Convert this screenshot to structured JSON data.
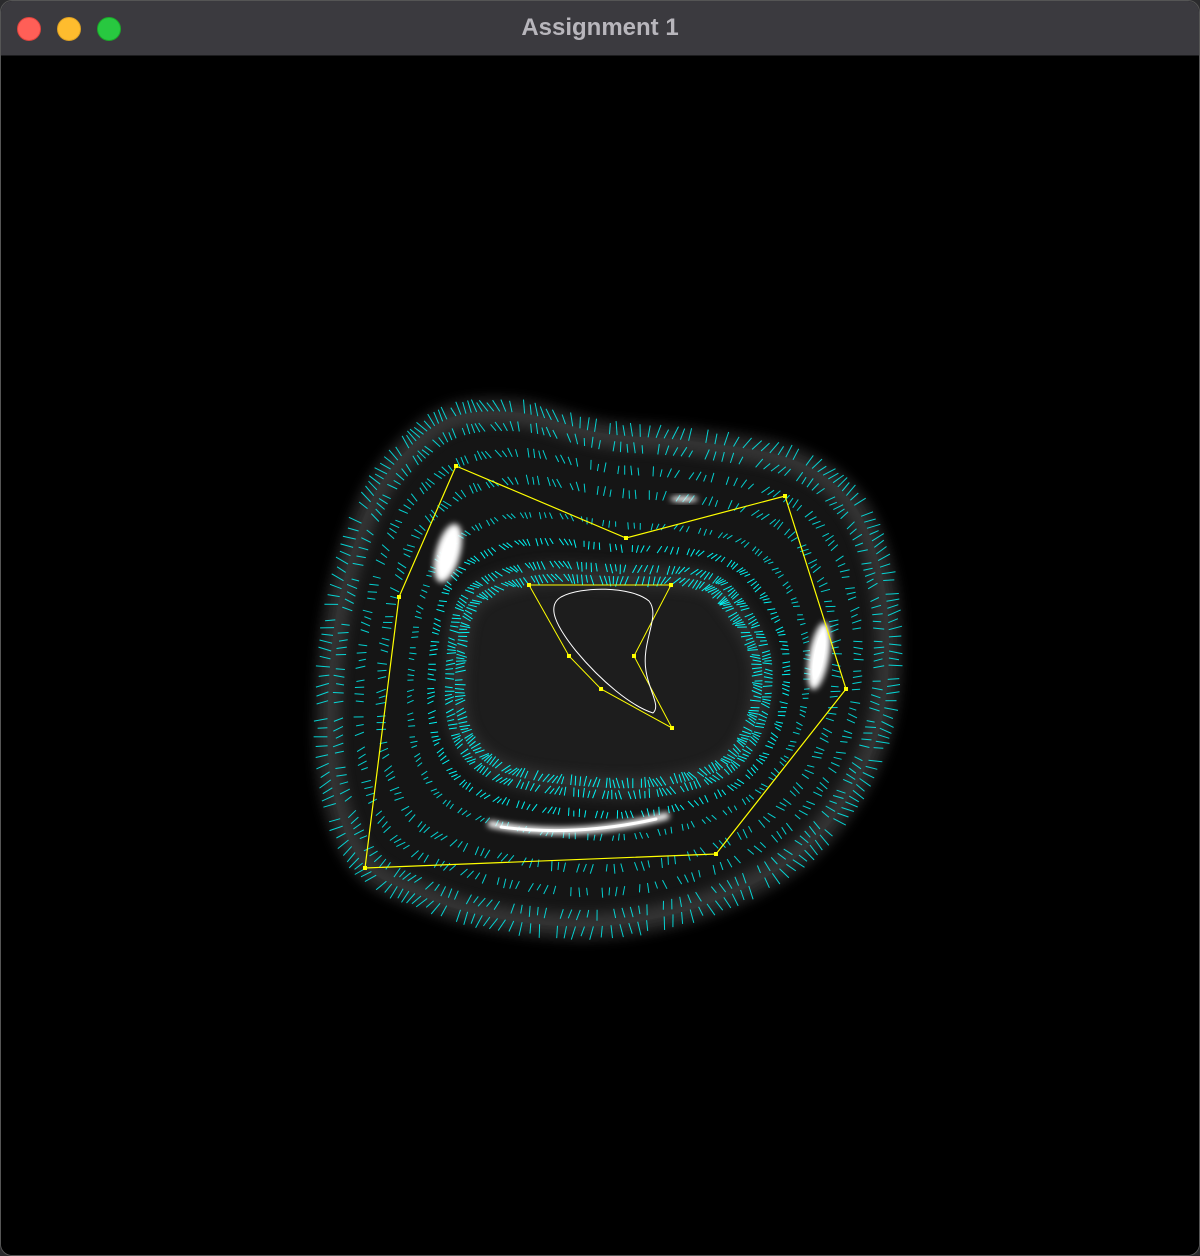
{
  "window": {
    "title": "Assignment 1"
  },
  "controls": {
    "close": "close-window",
    "minimize": "minimize-window",
    "zoom": "zoom-window"
  },
  "colors": {
    "background": "#000000",
    "normals": "#00ffff",
    "control_polygon": "#ffff00",
    "profile_curve": "#ffffff",
    "surface": "#cfcfcf"
  }
}
